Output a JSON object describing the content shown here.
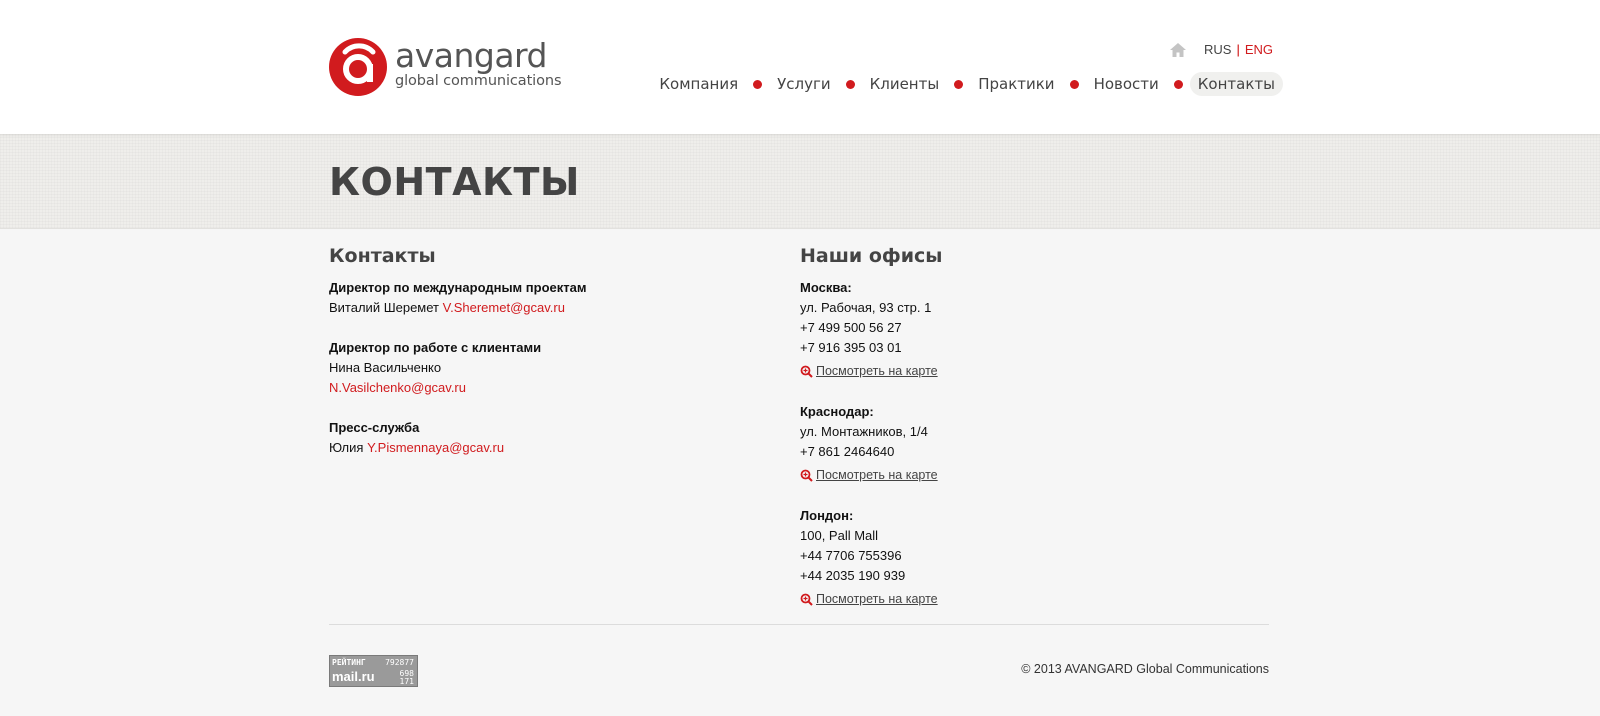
{
  "brand": {
    "name": "avangard",
    "tagline": "global communications",
    "accent_color": "#d11b1e"
  },
  "lang": {
    "rus": "RUS",
    "sep": "|",
    "eng": "ENG"
  },
  "nav": {
    "items": [
      {
        "label": "Компания"
      },
      {
        "label": "Услуги"
      },
      {
        "label": "Клиенты"
      },
      {
        "label": "Практики"
      },
      {
        "label": "Новости"
      },
      {
        "label": "Контакты",
        "active": true
      }
    ]
  },
  "page_title": "КОНТАКТЫ",
  "contacts": {
    "title": "Контакты",
    "blocks": [
      {
        "role": "Директор по международным проектам",
        "name": "Виталий Шеремет",
        "email": "V.Sheremet@gcav.ru"
      },
      {
        "role": "Директор по работе с клиентами",
        "name": "Нина Васильченко",
        "email": "N.Vasilchenko@gcav.ru"
      },
      {
        "role": "Пресс-служба",
        "name": "Юлия",
        "email": "Y.Pismennaya@gcav.ru"
      }
    ]
  },
  "offices": {
    "title": "Наши офисы",
    "map_link": "Посмотреть на карте",
    "items": [
      {
        "city": "Москва:",
        "lines": [
          "ул. Рабочая, 93 стр. 1",
          "+7 499 500 56 27",
          "+7 916 395 03 01"
        ]
      },
      {
        "city": "Краснодар:",
        "lines": [
          "ул. Монтажников, 1/4",
          "+7 861 2464640"
        ]
      },
      {
        "city": "Лондон:",
        "lines": [
          "100, Pall Mall",
          "+44 7706 755396",
          "+44 2035 190 939"
        ]
      }
    ]
  },
  "footer": {
    "counter": {
      "label": "РЕЙТИНГ",
      "brand": "mail.ru",
      "n1": "792877",
      "n2": "698",
      "n3": "171"
    },
    "copyright": "© 2013 AVANGARD Global Communications"
  }
}
